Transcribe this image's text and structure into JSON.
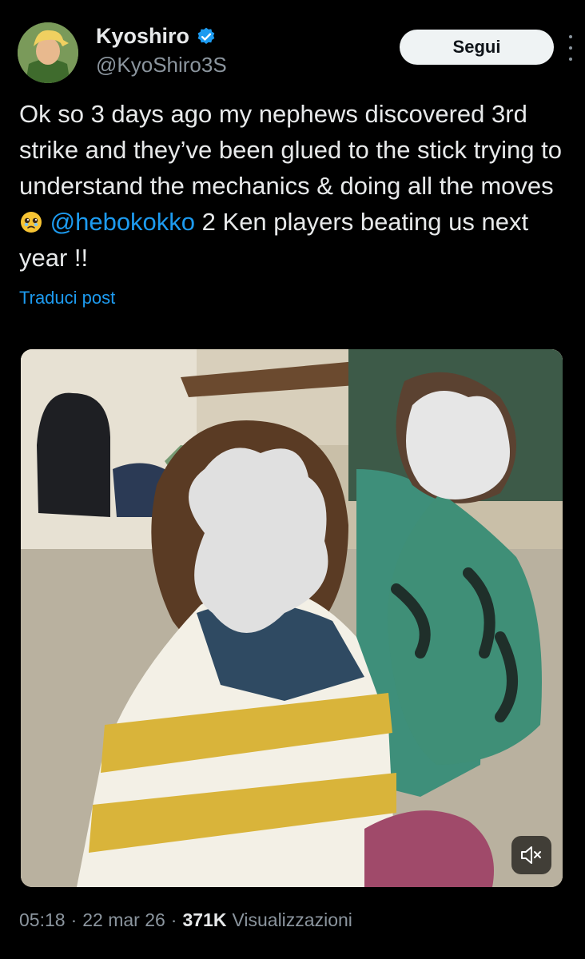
{
  "author": {
    "display_name": "Kyoshiro",
    "handle": "@KyoShiro3S",
    "verified": true
  },
  "actions": {
    "follow_label": "Segui"
  },
  "tweet": {
    "text_main": "Ok so 3 days ago my nephews discovered 3rd strike and they’ve been glued to the stick trying to understand the mechanics & doing all the moves",
    "mention": "@hebokokko",
    "text_after": " 2 Ken players beating us next year !!",
    "translate_label": "Traduci post"
  },
  "meta": {
    "time": "05:18",
    "date": "22 mar 26",
    "views_count": "371K",
    "views_label": "Visualizzazioni",
    "separator": "·"
  },
  "icons": {
    "verified": "verified-badge-icon",
    "more": "more-vertical-icon",
    "emoji": "teary-face-emoji",
    "mute": "speaker-muted-icon"
  },
  "colors": {
    "background": "#000000",
    "link": "#1d9bf0",
    "muted_text": "#8b959e",
    "verified": "#1d9bf0"
  }
}
